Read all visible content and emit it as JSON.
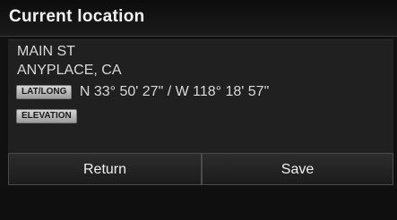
{
  "header": {
    "title": "Current location"
  },
  "address": {
    "street": "MAIN ST",
    "city": "ANYPLACE, CA"
  },
  "coordinates": {
    "latlong_tag": "LAT/LONG",
    "value": "N 33° 50' 27\" / W 118° 18' 57\""
  },
  "elevation": {
    "tag": "ELEVATION"
  },
  "actions": {
    "return_label": "Return",
    "save_label": "Save"
  }
}
